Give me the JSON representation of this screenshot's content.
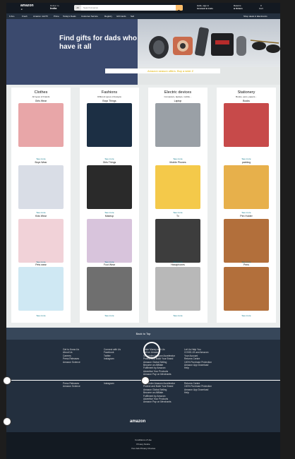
{
  "header": {
    "logo": "amazon",
    "logo_sub": ".in",
    "deliver_line1": "Deliver to",
    "deliver_line2": "India",
    "search_category": "All",
    "search_placeholder": "Search Amazon",
    "account_line1": "Hello, sign in",
    "account_line2": "Account & Lists",
    "returns_line1": "Returns",
    "returns_line2": "& Orders",
    "cart_label": "Cart",
    "cart_count": "0"
  },
  "nav": {
    "items": [
      "≡ ALL",
      "Fresh",
      "Amazon miniTV",
      "Prime",
      "Today's Deals",
      "Customer Service",
      "Registry",
      "Gift Cards",
      "Sell"
    ],
    "right": "Shop deals in Electronics"
  },
  "hero": {
    "title": "Find gifts for dads who have it all",
    "strip_text": "Amazon season offers. Buy a wide Z"
  },
  "cards": [
    {
      "title": "Clothes",
      "subtitle": "All types of brands",
      "items": [
        {
          "label": "Girls Wear",
          "more": "See more",
          "color": "#e8a6a8"
        },
        {
          "label": "Boys Wear",
          "more": "See more",
          "color": "#d9dde6"
        },
        {
          "label": "Kids Wear",
          "more": "See more",
          "color": "#f1d2d8"
        },
        {
          "label": "Pets wear",
          "more": "See more",
          "color": "#cfe8f3"
        }
      ]
    },
    {
      "title": "Fashions",
      "subtitle": "Different types of designs",
      "items": [
        {
          "label": "Boys Things",
          "more": "See more",
          "color": "#1c2f44"
        },
        {
          "label": "Girls Things",
          "more": "See more",
          "color": "#2a2a2a"
        },
        {
          "label": "Makeup",
          "more": "See more",
          "color": "#d8c4dc"
        },
        {
          "label": "Foot Wear",
          "more": "See more",
          "color": "#6f6f6f"
        }
      ]
    },
    {
      "title": "Electric devices",
      "subtitle": "Computers, laptops, mobile...",
      "items": [
        {
          "label": "Laptop",
          "more": "See more",
          "color": "#9aa0a6"
        },
        {
          "label": "Mobile Phones",
          "more": "See more",
          "color": "#f4c94a"
        },
        {
          "label": "Tv",
          "more": "See more",
          "color": "#3d3d3d"
        },
        {
          "label": "Headphones",
          "more": "See more",
          "color": "#b8b8b8"
        }
      ]
    },
    {
      "title": "Stationery",
      "subtitle": "Books, pens, papers...",
      "items": [
        {
          "label": "Books",
          "more": "See more",
          "color": "#c74a4a"
        },
        {
          "label": "painting",
          "more": "See more",
          "color": "#e7b04b"
        },
        {
          "label": "Pen Holder",
          "more": "See more",
          "color": "#b26f3b"
        },
        {
          "label": "Pens",
          "more": "See more",
          "color": "#b26f3b"
        }
      ]
    }
  ],
  "footer": {
    "back_to_top": "Back to Top",
    "col1": [
      "Get to Know Us",
      "About Us",
      "Careers",
      "Press Releases",
      "Amazon Science"
    ],
    "col2": [
      "Connect with Us",
      "Facebook",
      "Twitter",
      "Instagram"
    ],
    "col3": [
      "Make Money with Us",
      "Sell on Amazon",
      "Sell under Amazon Accelerator",
      "Protect and Build Your Brand",
      "Amazon Global Selling",
      "Become an Affiliate",
      "Fulfilment by Amazon",
      "Advertise Your Products",
      "Amazon Pay on Merchants"
    ],
    "col4": [
      "Let Us Help You",
      "COVID-19 and Amazon",
      "Your Account",
      "Returns Centre",
      "100% Purchase Protection",
      "Amazon App Download",
      "Help"
    ],
    "col1b": [
      "Press Releases",
      "Amazon Science"
    ],
    "col2b": [
      "Instagram"
    ],
    "col3b": [
      "Sell under Amazon Accelerator",
      "Protect and Build Your Brand",
      "Amazon Global Selling",
      "Become an Affiliate",
      "Fulfilment by Amazon",
      "Advertise Your Products",
      "Amazon Pay on Merchants"
    ],
    "col4b": [
      "Returns Centre",
      "100% Purchase Protection",
      "Amazon App Download",
      "Help"
    ],
    "logo": "amazon",
    "bottom": [
      "Conditions of Use",
      "Privacy Notice",
      "Your Ads Privacy Choices"
    ]
  },
  "colors": {
    "header_bg": "#131921",
    "nav_bg": "#232f3e",
    "search_button": "#febd69",
    "link": "#007185"
  }
}
